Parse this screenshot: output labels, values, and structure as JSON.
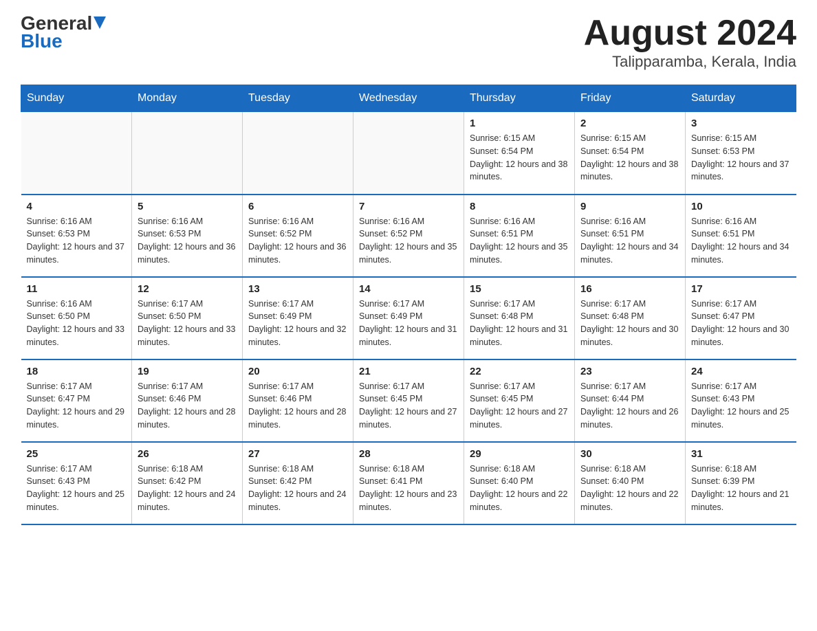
{
  "logo": {
    "general": "General",
    "blue": "Blue"
  },
  "header": {
    "month": "August 2024",
    "location": "Talipparamba, Kerala, India"
  },
  "days_of_week": [
    "Sunday",
    "Monday",
    "Tuesday",
    "Wednesday",
    "Thursday",
    "Friday",
    "Saturday"
  ],
  "weeks": [
    [
      {
        "day": "",
        "info": ""
      },
      {
        "day": "",
        "info": ""
      },
      {
        "day": "",
        "info": ""
      },
      {
        "day": "",
        "info": ""
      },
      {
        "day": "1",
        "info": "Sunrise: 6:15 AM\nSunset: 6:54 PM\nDaylight: 12 hours and 38 minutes."
      },
      {
        "day": "2",
        "info": "Sunrise: 6:15 AM\nSunset: 6:54 PM\nDaylight: 12 hours and 38 minutes."
      },
      {
        "day": "3",
        "info": "Sunrise: 6:15 AM\nSunset: 6:53 PM\nDaylight: 12 hours and 37 minutes."
      }
    ],
    [
      {
        "day": "4",
        "info": "Sunrise: 6:16 AM\nSunset: 6:53 PM\nDaylight: 12 hours and 37 minutes."
      },
      {
        "day": "5",
        "info": "Sunrise: 6:16 AM\nSunset: 6:53 PM\nDaylight: 12 hours and 36 minutes."
      },
      {
        "day": "6",
        "info": "Sunrise: 6:16 AM\nSunset: 6:52 PM\nDaylight: 12 hours and 36 minutes."
      },
      {
        "day": "7",
        "info": "Sunrise: 6:16 AM\nSunset: 6:52 PM\nDaylight: 12 hours and 35 minutes."
      },
      {
        "day": "8",
        "info": "Sunrise: 6:16 AM\nSunset: 6:51 PM\nDaylight: 12 hours and 35 minutes."
      },
      {
        "day": "9",
        "info": "Sunrise: 6:16 AM\nSunset: 6:51 PM\nDaylight: 12 hours and 34 minutes."
      },
      {
        "day": "10",
        "info": "Sunrise: 6:16 AM\nSunset: 6:51 PM\nDaylight: 12 hours and 34 minutes."
      }
    ],
    [
      {
        "day": "11",
        "info": "Sunrise: 6:16 AM\nSunset: 6:50 PM\nDaylight: 12 hours and 33 minutes."
      },
      {
        "day": "12",
        "info": "Sunrise: 6:17 AM\nSunset: 6:50 PM\nDaylight: 12 hours and 33 minutes."
      },
      {
        "day": "13",
        "info": "Sunrise: 6:17 AM\nSunset: 6:49 PM\nDaylight: 12 hours and 32 minutes."
      },
      {
        "day": "14",
        "info": "Sunrise: 6:17 AM\nSunset: 6:49 PM\nDaylight: 12 hours and 31 minutes."
      },
      {
        "day": "15",
        "info": "Sunrise: 6:17 AM\nSunset: 6:48 PM\nDaylight: 12 hours and 31 minutes."
      },
      {
        "day": "16",
        "info": "Sunrise: 6:17 AM\nSunset: 6:48 PM\nDaylight: 12 hours and 30 minutes."
      },
      {
        "day": "17",
        "info": "Sunrise: 6:17 AM\nSunset: 6:47 PM\nDaylight: 12 hours and 30 minutes."
      }
    ],
    [
      {
        "day": "18",
        "info": "Sunrise: 6:17 AM\nSunset: 6:47 PM\nDaylight: 12 hours and 29 minutes."
      },
      {
        "day": "19",
        "info": "Sunrise: 6:17 AM\nSunset: 6:46 PM\nDaylight: 12 hours and 28 minutes."
      },
      {
        "day": "20",
        "info": "Sunrise: 6:17 AM\nSunset: 6:46 PM\nDaylight: 12 hours and 28 minutes."
      },
      {
        "day": "21",
        "info": "Sunrise: 6:17 AM\nSunset: 6:45 PM\nDaylight: 12 hours and 27 minutes."
      },
      {
        "day": "22",
        "info": "Sunrise: 6:17 AM\nSunset: 6:45 PM\nDaylight: 12 hours and 27 minutes."
      },
      {
        "day": "23",
        "info": "Sunrise: 6:17 AM\nSunset: 6:44 PM\nDaylight: 12 hours and 26 minutes."
      },
      {
        "day": "24",
        "info": "Sunrise: 6:17 AM\nSunset: 6:43 PM\nDaylight: 12 hours and 25 minutes."
      }
    ],
    [
      {
        "day": "25",
        "info": "Sunrise: 6:17 AM\nSunset: 6:43 PM\nDaylight: 12 hours and 25 minutes."
      },
      {
        "day": "26",
        "info": "Sunrise: 6:18 AM\nSunset: 6:42 PM\nDaylight: 12 hours and 24 minutes."
      },
      {
        "day": "27",
        "info": "Sunrise: 6:18 AM\nSunset: 6:42 PM\nDaylight: 12 hours and 24 minutes."
      },
      {
        "day": "28",
        "info": "Sunrise: 6:18 AM\nSunset: 6:41 PM\nDaylight: 12 hours and 23 minutes."
      },
      {
        "day": "29",
        "info": "Sunrise: 6:18 AM\nSunset: 6:40 PM\nDaylight: 12 hours and 22 minutes."
      },
      {
        "day": "30",
        "info": "Sunrise: 6:18 AM\nSunset: 6:40 PM\nDaylight: 12 hours and 22 minutes."
      },
      {
        "day": "31",
        "info": "Sunrise: 6:18 AM\nSunset: 6:39 PM\nDaylight: 12 hours and 21 minutes."
      }
    ]
  ]
}
